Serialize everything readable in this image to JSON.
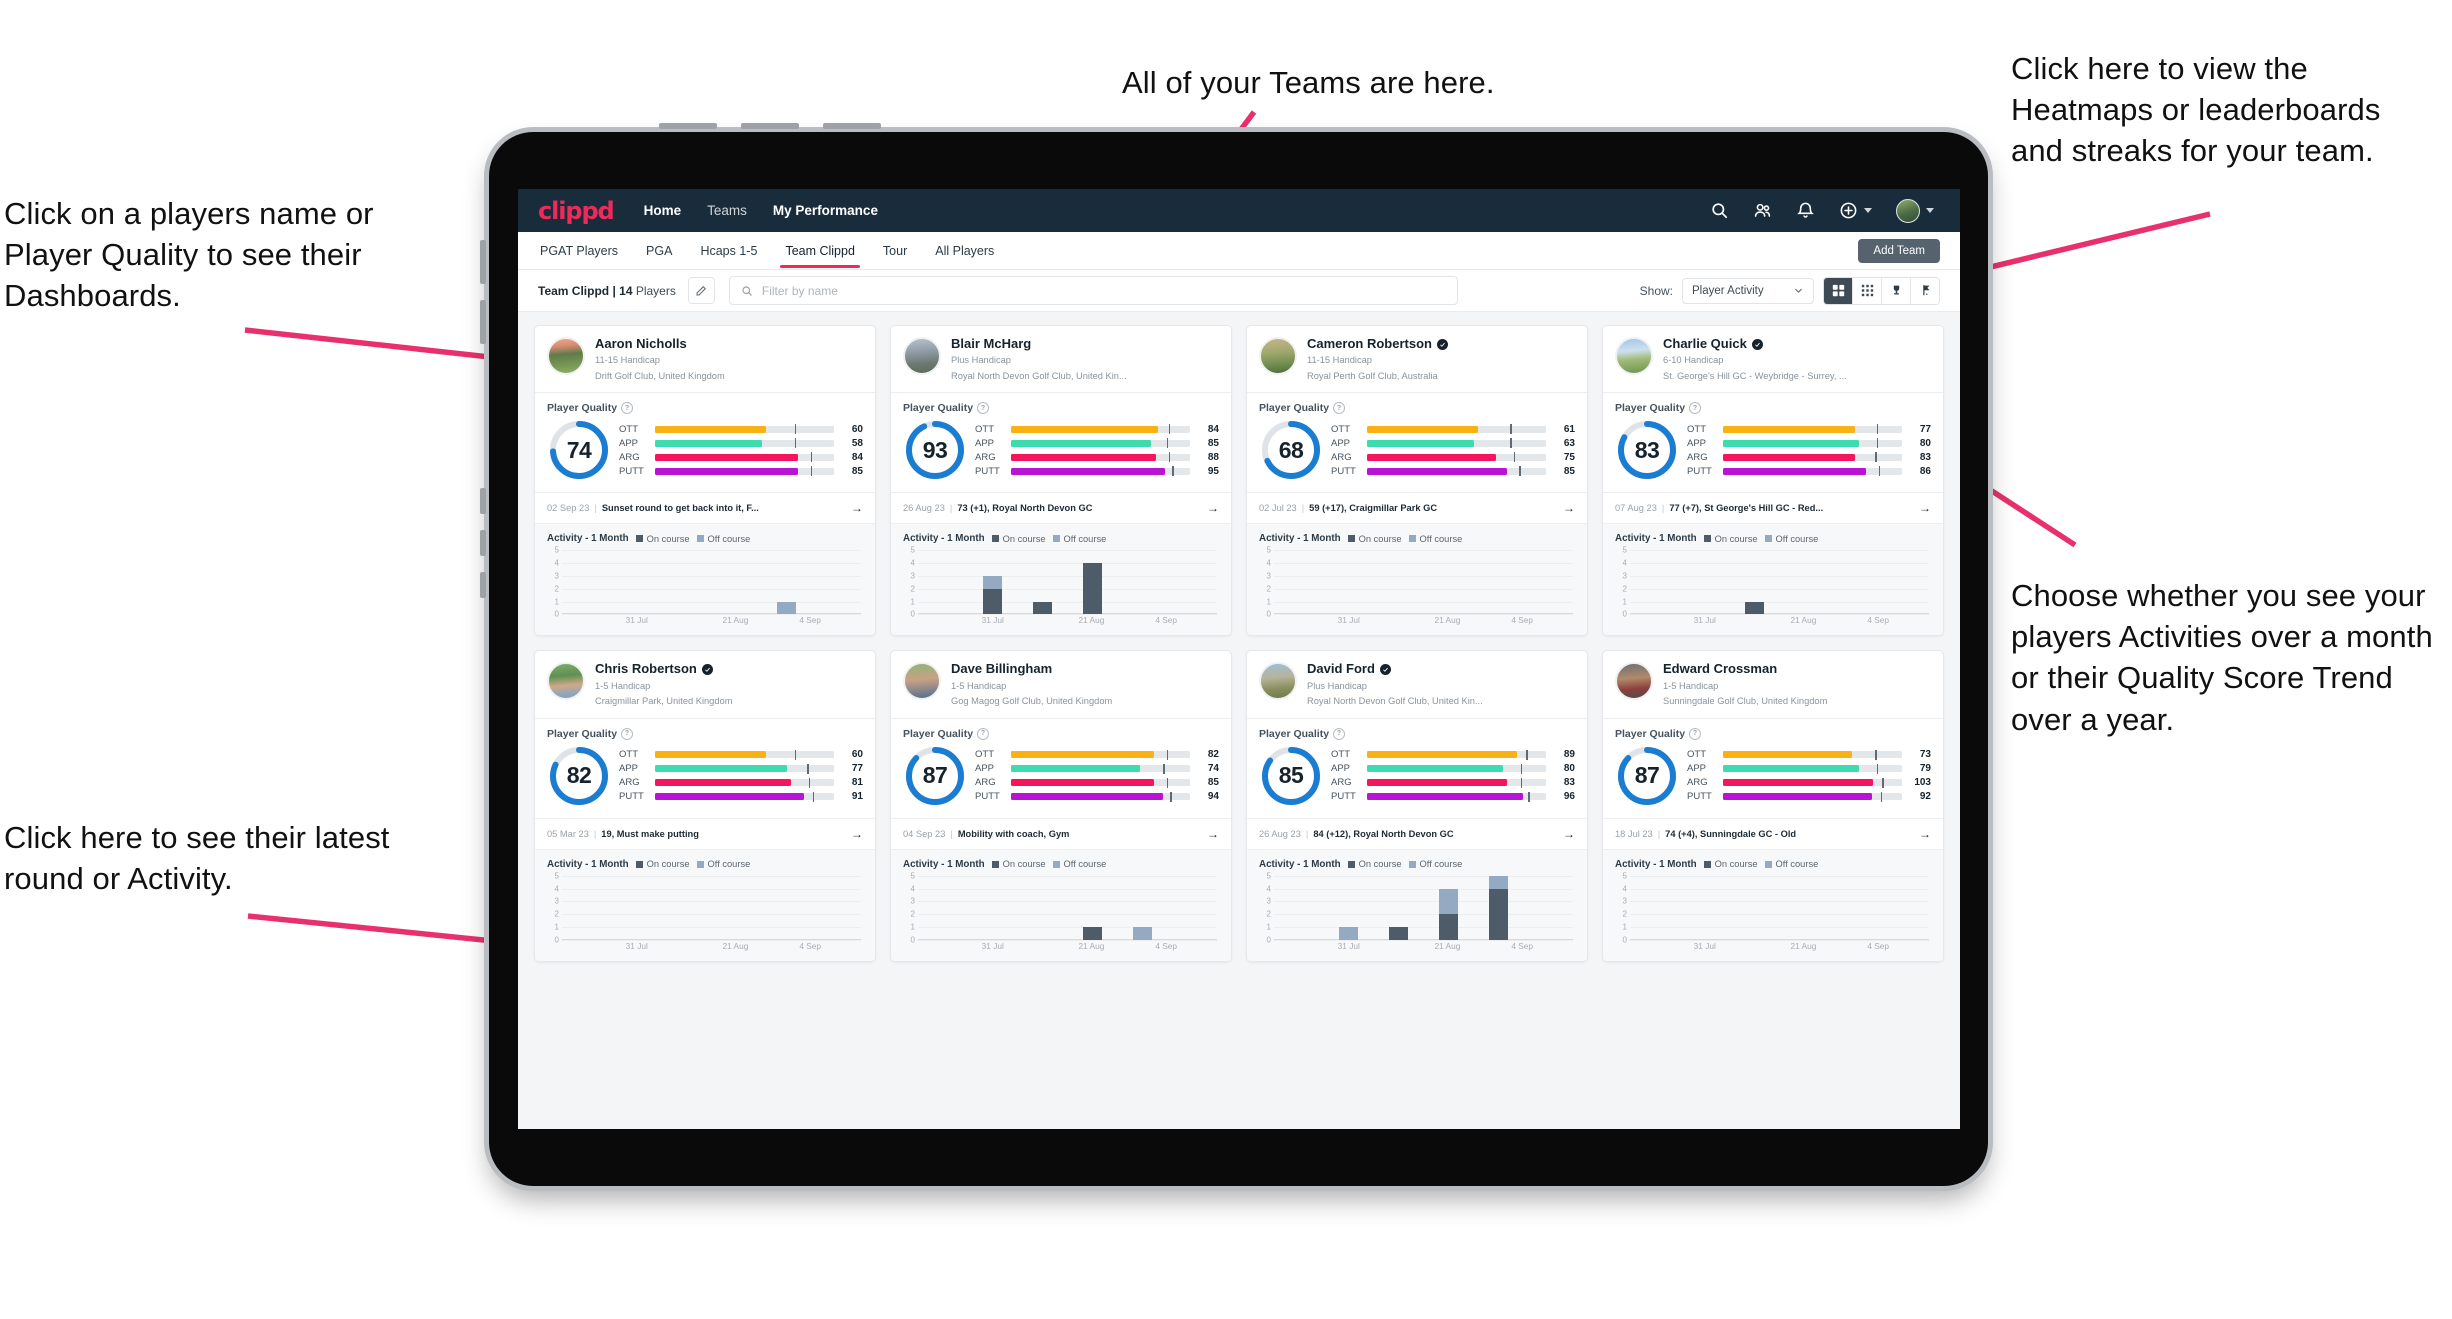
{
  "annotations": {
    "top_left": "Click on a players name or Player Quality to see their Dashboards.",
    "bottom_left": "Click here to see their latest round or Activity.",
    "top_center": "All of your Teams are here.",
    "top_right": "Click here to view the Heatmaps or leaderboards and streaks for your team.",
    "right_middle": "Choose whether you see your players Activities over a month or their Quality Score Trend over a year."
  },
  "colors": {
    "accent_pink": "#ef2a5b",
    "navbar": "#182c3b",
    "ott": "#f9b114",
    "app": "#3ddcb0",
    "arg": "#f5145e",
    "putt": "#b914d6",
    "ring": "#1b7dd1",
    "on_course": "#4e5c69",
    "off_course": "#93aac2"
  },
  "navbar": {
    "brand": "clippd",
    "links": [
      {
        "label": "Home",
        "active": true
      },
      {
        "label": "Teams",
        "active": false
      },
      {
        "label": "My Performance",
        "active": true
      }
    ],
    "icons": [
      "search-icon",
      "people-icon",
      "bell-icon",
      "plus-circle-icon",
      "avatar"
    ]
  },
  "tabs": [
    {
      "label": "PGAT Players",
      "active": false
    },
    {
      "label": "PGA",
      "active": false
    },
    {
      "label": "Hcaps 1-5",
      "active": false
    },
    {
      "label": "Team Clippd",
      "active": true
    },
    {
      "label": "Tour",
      "active": false
    },
    {
      "label": "All Players",
      "active": false
    }
  ],
  "add_team_button": "Add Team",
  "filter_bar": {
    "team_label_bold": "Team Clippd | 14",
    "team_label_rest": " Players",
    "search_placeholder": "Filter by name",
    "show_label": "Show:",
    "show_value": "Player Activity",
    "view_buttons": [
      "grid-large-icon",
      "grid-small-icon",
      "trophy-icon",
      "flag-icon"
    ],
    "active_view_index": 0
  },
  "card_labels": {
    "player_quality": "Player Quality",
    "activity": "Activity - 1 Month",
    "legend_on": "On course",
    "legend_off": "Off course",
    "metric_names": [
      "OTT",
      "APP",
      "ARG",
      "PUTT"
    ],
    "y_ticks": [
      "5",
      "4",
      "3",
      "2",
      "1",
      "0"
    ],
    "x_ticks": [
      "31 Jul",
      "21 Aug",
      "4 Sep"
    ]
  },
  "players": [
    {
      "name": "Aaron Nicholls",
      "verified": false,
      "handicap": "11-15 Handicap",
      "club": "Drift Golf Club, United Kingdom",
      "quality": 74,
      "metrics": [
        {
          "name": "OTT",
          "value": 60,
          "fill": 62,
          "tick": 78
        },
        {
          "name": "APP",
          "value": 58,
          "fill": 60,
          "tick": 78
        },
        {
          "name": "ARG",
          "value": 84,
          "fill": 80,
          "tick": 87
        },
        {
          "name": "PUTT",
          "value": 85,
          "fill": 80,
          "tick": 87
        }
      ],
      "round_date": "02 Sep 23",
      "round_text": "Sunset round to get back into it, F...",
      "avatar_style": "course-sunset",
      "activity": [
        {
          "on": 0,
          "off": 0
        },
        {
          "on": 0,
          "off": 0
        },
        {
          "on": 0,
          "off": 0
        },
        {
          "on": 0,
          "off": 0
        },
        {
          "on": 0,
          "off": 1
        },
        {
          "on": 0,
          "off": 0
        }
      ]
    },
    {
      "name": "Blair McHarg",
      "verified": false,
      "handicap": "Plus Handicap",
      "club": "Royal North Devon Golf Club, United Kin...",
      "quality": 93,
      "metrics": [
        {
          "name": "OTT",
          "value": 84,
          "fill": 82,
          "tick": 88
        },
        {
          "name": "APP",
          "value": 85,
          "fill": 78,
          "tick": 87
        },
        {
          "name": "ARG",
          "value": 88,
          "fill": 81,
          "tick": 88
        },
        {
          "name": "PUTT",
          "value": 95,
          "fill": 86,
          "tick": 90
        }
      ],
      "round_date": "26 Aug 23",
      "round_text": "73 (+1), Royal North Devon GC",
      "avatar_style": "course-grey",
      "activity": [
        {
          "on": 0,
          "off": 0
        },
        {
          "on": 2,
          "off": 1
        },
        {
          "on": 1,
          "off": 0
        },
        {
          "on": 4,
          "off": 0
        },
        {
          "on": 0,
          "off": 0
        },
        {
          "on": 0,
          "off": 0
        }
      ]
    },
    {
      "name": "Cameron Robertson",
      "verified": true,
      "handicap": "11-15 Handicap",
      "club": "Royal Perth Golf Club, Australia",
      "quality": 68,
      "metrics": [
        {
          "name": "OTT",
          "value": 61,
          "fill": 62,
          "tick": 80
        },
        {
          "name": "APP",
          "value": 63,
          "fill": 60,
          "tick": 80
        },
        {
          "name": "ARG",
          "value": 75,
          "fill": 72,
          "tick": 82
        },
        {
          "name": "PUTT",
          "value": 85,
          "fill": 78,
          "tick": 85
        }
      ],
      "round_date": "02 Jul 23",
      "round_text": "59 (+17), Craigmillar Park GC",
      "avatar_style": "course-tan",
      "activity": [
        {
          "on": 0,
          "off": 0
        },
        {
          "on": 0,
          "off": 0
        },
        {
          "on": 0,
          "off": 0
        },
        {
          "on": 0,
          "off": 0
        },
        {
          "on": 0,
          "off": 0
        },
        {
          "on": 0,
          "off": 0
        }
      ]
    },
    {
      "name": "Charlie Quick",
      "verified": true,
      "handicap": "6-10 Handicap",
      "club": "St. George's Hill GC - Weybridge - Surrey, ...",
      "quality": 83,
      "metrics": [
        {
          "name": "OTT",
          "value": 77,
          "fill": 74,
          "tick": 86
        },
        {
          "name": "APP",
          "value": 80,
          "fill": 76,
          "tick": 86
        },
        {
          "name": "ARG",
          "value": 83,
          "fill": 74,
          "tick": 85
        },
        {
          "name": "PUTT",
          "value": 86,
          "fill": 80,
          "tick": 87
        }
      ],
      "round_date": "07 Aug 23",
      "round_text": "77 (+7), St George's Hill GC - Red...",
      "avatar_style": "course-sky",
      "activity": [
        {
          "on": 0,
          "off": 0
        },
        {
          "on": 0,
          "off": 0
        },
        {
          "on": 1,
          "off": 0
        },
        {
          "on": 0,
          "off": 0
        },
        {
          "on": 0,
          "off": 0
        },
        {
          "on": 0,
          "off": 0
        }
      ]
    },
    {
      "name": "Chris Robertson",
      "verified": true,
      "handicap": "1-5 Handicap",
      "club": "Craigmillar Park, United Kingdom",
      "quality": 82,
      "metrics": [
        {
          "name": "OTT",
          "value": 60,
          "fill": 62,
          "tick": 78
        },
        {
          "name": "APP",
          "value": 77,
          "fill": 74,
          "tick": 85
        },
        {
          "name": "ARG",
          "value": 81,
          "fill": 76,
          "tick": 86
        },
        {
          "name": "PUTT",
          "value": 91,
          "fill": 83,
          "tick": 88
        }
      ],
      "round_date": "05 Mar 23",
      "round_text": "19, Must make putting",
      "avatar_style": "person-a",
      "activity": [
        {
          "on": 0,
          "off": 0
        },
        {
          "on": 0,
          "off": 0
        },
        {
          "on": 0,
          "off": 0
        },
        {
          "on": 0,
          "off": 0
        },
        {
          "on": 0,
          "off": 0
        },
        {
          "on": 0,
          "off": 0
        }
      ]
    },
    {
      "name": "Dave Billingham",
      "verified": false,
      "handicap": "1-5 Handicap",
      "club": "Gog Magog Golf Club, United Kingdom",
      "quality": 87,
      "metrics": [
        {
          "name": "OTT",
          "value": 82,
          "fill": 80,
          "tick": 87
        },
        {
          "name": "APP",
          "value": 74,
          "fill": 72,
          "tick": 85
        },
        {
          "name": "ARG",
          "value": 85,
          "fill": 80,
          "tick": 87
        },
        {
          "name": "PUTT",
          "value": 94,
          "fill": 85,
          "tick": 89
        }
      ],
      "round_date": "04 Sep 23",
      "round_text": "Mobility with coach, Gym",
      "avatar_style": "person-b",
      "activity": [
        {
          "on": 0,
          "off": 0
        },
        {
          "on": 0,
          "off": 0
        },
        {
          "on": 0,
          "off": 0
        },
        {
          "on": 1,
          "off": 0
        },
        {
          "on": 0,
          "off": 1
        },
        {
          "on": 0,
          "off": 0
        }
      ]
    },
    {
      "name": "David Ford",
      "verified": true,
      "handicap": "Plus Handicap",
      "club": "Royal North Devon Golf Club, United Kin...",
      "quality": 85,
      "metrics": [
        {
          "name": "OTT",
          "value": 89,
          "fill": 84,
          "tick": 89
        },
        {
          "name": "APP",
          "value": 80,
          "fill": 76,
          "tick": 86
        },
        {
          "name": "ARG",
          "value": 83,
          "fill": 78,
          "tick": 86
        },
        {
          "name": "PUTT",
          "value": 96,
          "fill": 87,
          "tick": 90
        }
      ],
      "round_date": "26 Aug 23",
      "round_text": "84 (+12), Royal North Devon GC",
      "avatar_style": "course-cliff",
      "activity": [
        {
          "on": 0,
          "off": 0
        },
        {
          "on": 0,
          "off": 1
        },
        {
          "on": 1,
          "off": 0
        },
        {
          "on": 2,
          "off": 2
        },
        {
          "on": 4,
          "off": 1
        },
        {
          "on": 0,
          "off": 0
        }
      ]
    },
    {
      "name": "Edward Crossman",
      "verified": false,
      "handicap": "1-5 Handicap",
      "club": "Sunningdale Golf Club, United Kingdom",
      "quality": 87,
      "metrics": [
        {
          "name": "OTT",
          "value": 73,
          "fill": 72,
          "tick": 85
        },
        {
          "name": "APP",
          "value": 79,
          "fill": 76,
          "tick": 86
        },
        {
          "name": "ARG",
          "value": 103,
          "fill": 84,
          "tick": 89
        },
        {
          "name": "PUTT",
          "value": 92,
          "fill": 83,
          "tick": 88
        }
      ],
      "round_date": "18 Jul 23",
      "round_text": "74 (+4), Sunningdale GC - Old",
      "avatar_style": "person-c",
      "activity": [
        {
          "on": 0,
          "off": 0
        },
        {
          "on": 0,
          "off": 0
        },
        {
          "on": 0,
          "off": 0
        },
        {
          "on": 0,
          "off": 0
        },
        {
          "on": 0,
          "off": 0
        },
        {
          "on": 0,
          "off": 0
        }
      ]
    }
  ]
}
